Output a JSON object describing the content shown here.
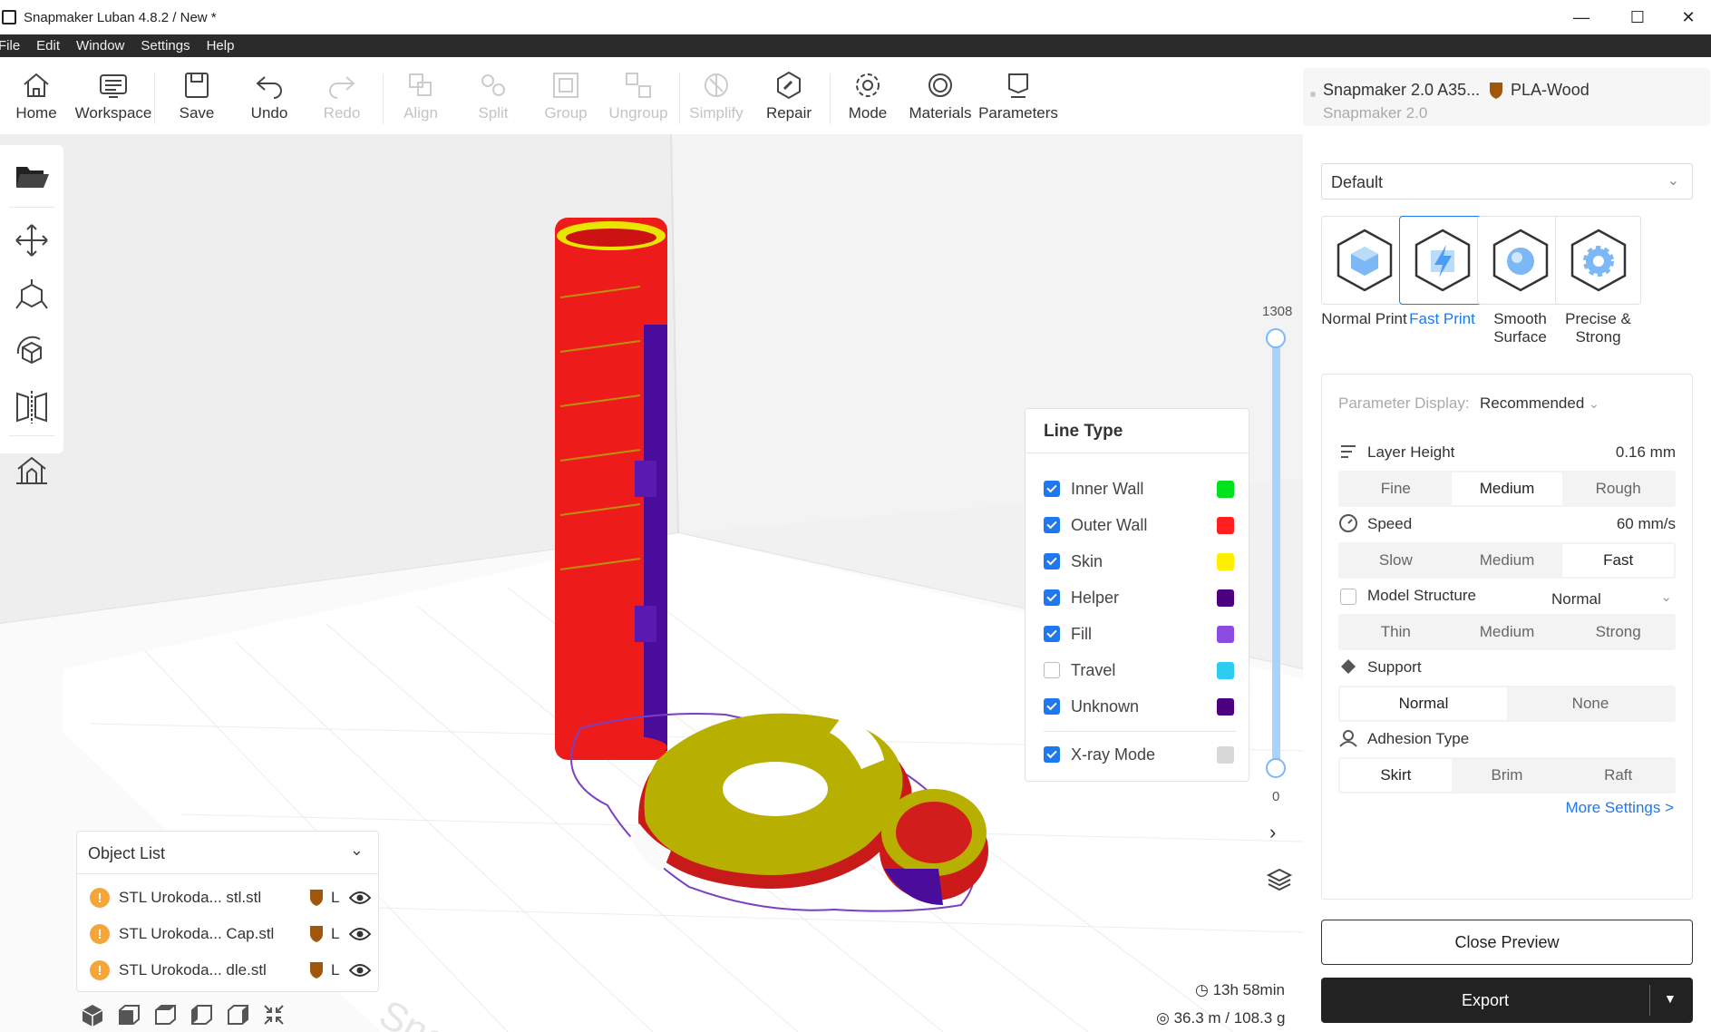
{
  "window": {
    "title": "Snapmaker Luban 4.8.2 / New *",
    "minimize": "—",
    "maximize": "☐",
    "close": "✕"
  },
  "menu": [
    "File",
    "Edit",
    "Window",
    "Settings",
    "Help"
  ],
  "toolbar": {
    "home": "Home",
    "workspace": "Workspace",
    "save": "Save",
    "undo": "Undo",
    "redo": "Redo",
    "align": "Align",
    "split": "Split",
    "group": "Group",
    "ungroup": "Ungroup",
    "simplify": "Simplify",
    "repair": "Repair",
    "mode": "Mode",
    "materials": "Materials",
    "parameters": "Parameters"
  },
  "machine": {
    "name": "Snapmaker 2.0 A35...",
    "series": "Snapmaker 2.0",
    "material": "PLA-Wood",
    "material_color": "#a0560b"
  },
  "line_type": {
    "title": "Line Type",
    "items": [
      {
        "name": "Inner Wall",
        "checked": true,
        "color": "#00e21e"
      },
      {
        "name": "Outer Wall",
        "checked": true,
        "color": "#ff1f1f"
      },
      {
        "name": "Skin",
        "checked": true,
        "color": "#ffee00"
      },
      {
        "name": "Helper",
        "checked": true,
        "color": "#4b0082"
      },
      {
        "name": "Fill",
        "checked": true,
        "color": "#8c4ae0"
      },
      {
        "name": "Travel",
        "checked": false,
        "color": "#2dccf0"
      },
      {
        "name": "Unknown",
        "checked": true,
        "color": "#4b0082"
      }
    ],
    "xray": {
      "name": "X-ray Mode",
      "checked": true,
      "color": "#d8d8d8"
    }
  },
  "layers": {
    "top": "1308",
    "bottom": "0"
  },
  "object_list": {
    "title": "Object List",
    "items": [
      {
        "name": "STL Urokoda... stl.stl",
        "extruder": "L"
      },
      {
        "name": "STL Urokoda... Cap.stl",
        "extruder": "L"
      },
      {
        "name": "STL Urokoda... dle.stl",
        "extruder": "L"
      }
    ]
  },
  "stats": {
    "time": "13h 58min",
    "usage": "36.3 m / 108.3 g"
  },
  "watermark": "Snap",
  "right_panel": {
    "preset": "Default",
    "profiles": [
      {
        "label": "Normal Print",
        "selected": false
      },
      {
        "label": "Fast Print",
        "selected": true
      },
      {
        "label": "Smooth Surface",
        "selected": false
      },
      {
        "label": "Precise & Strong",
        "selected": false
      }
    ],
    "param_display_label": "Parameter Display:",
    "param_display_value": "Recommended",
    "layer_height": {
      "label": "Layer Height",
      "value": "0.16 mm",
      "options": [
        "Fine",
        "Medium",
        "Rough"
      ],
      "selected": "Medium"
    },
    "speed": {
      "label": "Speed",
      "value": "60 mm/s",
      "options": [
        "Slow",
        "Medium",
        "Fast"
      ],
      "selected": "Fast"
    },
    "model_structure": {
      "label": "Model Structure",
      "value": "Normal",
      "options": [
        "Thin",
        "Medium",
        "Strong"
      ],
      "selected": ""
    },
    "support": {
      "label": "Support",
      "options": [
        "Normal",
        "None"
      ],
      "selected": "Normal"
    },
    "adhesion": {
      "label": "Adhesion Type",
      "options": [
        "Skirt",
        "Brim",
        "Raft"
      ],
      "selected": "Skirt"
    },
    "more_settings": "More Settings >",
    "close_preview": "Close Preview",
    "export": "Export"
  }
}
